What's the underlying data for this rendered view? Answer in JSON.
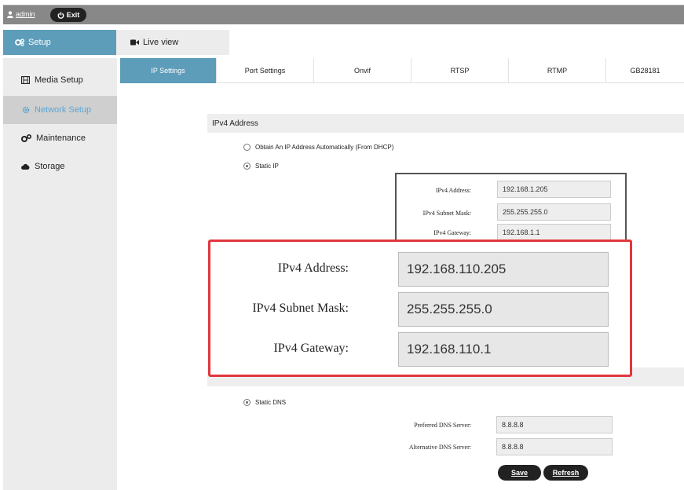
{
  "topbar": {
    "username": "admin",
    "exit_label": "Exit"
  },
  "main_tabs": [
    {
      "label": "Setup",
      "icon": "gears-icon",
      "active": true
    },
    {
      "label": "Live view",
      "icon": "video-camera-icon",
      "active": false
    }
  ],
  "sidebar": {
    "items": [
      {
        "label": "Media Setup",
        "icon": "film-icon"
      },
      {
        "label": "Network Setup",
        "icon": "gear-icon",
        "active": true
      },
      {
        "label": "Maintenance",
        "icon": "cogs-icon"
      },
      {
        "label": "Storage",
        "icon": "cloud-icon"
      }
    ]
  },
  "subtabs": [
    "IP Settings",
    "Port Settings",
    "Onvif",
    "RTSP",
    "RTMP",
    "GB28181"
  ],
  "ipv4": {
    "section_title": "IPv4 Address",
    "dhcp_label": "Obtain An IP Address Automatically (From DHCP)",
    "static_label": "Static IP",
    "address_label": "IPv4 Address:",
    "address_value": "192.168.1.205",
    "mask_label": "IPv4 Subnet Mask:",
    "mask_value": "255.255.255.0",
    "gateway_label": "IPv4 Gateway:",
    "gateway_value": "192.168.1.1"
  },
  "zoom_callout": {
    "address_label": "IPv4 Address:",
    "address_value": "192.168.110.205",
    "mask_label": "IPv4 Subnet Mask:",
    "mask_value": "255.255.255.0",
    "gateway_label": "IPv4 Gateway:",
    "gateway_value": "192.168.110.1",
    "border_color": "#e2363d"
  },
  "dns": {
    "static_label": "Static DNS",
    "preferred_label": "Preferred DNS Server:",
    "preferred_value": "8.8.8.8",
    "alternative_label": "Alternative DNS Server:",
    "alternative_value": "8.8.8.8"
  },
  "buttons": {
    "save": "Save",
    "refresh": "Refresh"
  },
  "colors": {
    "accent": "#5d9dba",
    "active_link": "#5aa7d3",
    "topbar": "#888888"
  }
}
